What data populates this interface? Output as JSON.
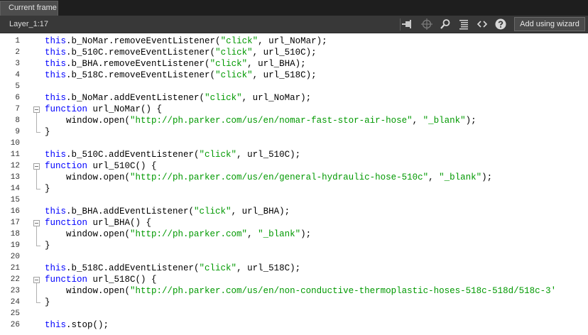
{
  "tab": {
    "label": "Current frame"
  },
  "toolbar": {
    "scope": "Layer_1:17",
    "wizard_label": "Add using wizard",
    "icons": [
      "pin-icon",
      "target-icon",
      "search-icon",
      "format-icon",
      "code-brackets-icon",
      "help-icon"
    ]
  },
  "colors": {
    "keyword": "#0000ff",
    "string": "#009900",
    "text": "#000000"
  },
  "lines": [
    {
      "num": "1",
      "tokens": [
        {
          "k": "kw",
          "t": "this"
        },
        {
          "k": "",
          "t": ".b_NoMar.removeEventListener("
        },
        {
          "k": "str",
          "t": "\"click\""
        },
        {
          "k": "",
          "t": ", url_NoMar);"
        }
      ]
    },
    {
      "num": "2",
      "tokens": [
        {
          "k": "kw",
          "t": "this"
        },
        {
          "k": "",
          "t": ".b_510C.removeEventListener("
        },
        {
          "k": "str",
          "t": "\"click\""
        },
        {
          "k": "",
          "t": ", url_510C);"
        }
      ]
    },
    {
      "num": "3",
      "tokens": [
        {
          "k": "kw",
          "t": "this"
        },
        {
          "k": "",
          "t": ".b_BHA.removeEventListener("
        },
        {
          "k": "str",
          "t": "\"click\""
        },
        {
          "k": "",
          "t": ", url_BHA);"
        }
      ]
    },
    {
      "num": "4",
      "tokens": [
        {
          "k": "kw",
          "t": "this"
        },
        {
          "k": "",
          "t": ".b_518C.removeEventListener("
        },
        {
          "k": "str",
          "t": "\"click\""
        },
        {
          "k": "",
          "t": ", url_518C);"
        }
      ]
    },
    {
      "num": "5",
      "tokens": []
    },
    {
      "num": "6",
      "tokens": [
        {
          "k": "kw",
          "t": "this"
        },
        {
          "k": "",
          "t": ".b_NoMar.addEventListener("
        },
        {
          "k": "str",
          "t": "\"click\""
        },
        {
          "k": "",
          "t": ", url_NoMar);"
        }
      ]
    },
    {
      "num": "7",
      "fold": true,
      "tokens": [
        {
          "k": "kw",
          "t": "function"
        },
        {
          "k": "",
          "t": " url_NoMar() {"
        }
      ]
    },
    {
      "num": "8",
      "tokens": [
        {
          "k": "",
          "t": "    window.open("
        },
        {
          "k": "str",
          "t": "\"http://ph.parker.com/us/en/nomar-fast-stor-air-hose\""
        },
        {
          "k": "",
          "t": ", "
        },
        {
          "k": "str",
          "t": "\"_blank\""
        },
        {
          "k": "",
          "t": ");"
        }
      ]
    },
    {
      "num": "9",
      "end": true,
      "tokens": [
        {
          "k": "",
          "t": "}"
        }
      ]
    },
    {
      "num": "10",
      "tokens": []
    },
    {
      "num": "11",
      "tokens": [
        {
          "k": "kw",
          "t": "this"
        },
        {
          "k": "",
          "t": ".b_510C.addEventListener("
        },
        {
          "k": "str",
          "t": "\"click\""
        },
        {
          "k": "",
          "t": ", url_510C);"
        }
      ]
    },
    {
      "num": "12",
      "fold": true,
      "tokens": [
        {
          "k": "kw",
          "t": "function"
        },
        {
          "k": "",
          "t": " url_510C() {"
        }
      ]
    },
    {
      "num": "13",
      "tokens": [
        {
          "k": "",
          "t": "    window.open("
        },
        {
          "k": "str",
          "t": "\"http://ph.parker.com/us/en/general-hydraulic-hose-510c\""
        },
        {
          "k": "",
          "t": ", "
        },
        {
          "k": "str",
          "t": "\"_blank\""
        },
        {
          "k": "",
          "t": ");"
        }
      ]
    },
    {
      "num": "14",
      "end": true,
      "tokens": [
        {
          "k": "",
          "t": "}"
        }
      ]
    },
    {
      "num": "15",
      "tokens": []
    },
    {
      "num": "16",
      "tokens": [
        {
          "k": "kw",
          "t": "this"
        },
        {
          "k": "",
          "t": ".b_BHA.addEventListener("
        },
        {
          "k": "str",
          "t": "\"click\""
        },
        {
          "k": "",
          "t": ", url_BHA);"
        }
      ]
    },
    {
      "num": "17",
      "fold": true,
      "tokens": [
        {
          "k": "kw",
          "t": "function"
        },
        {
          "k": "",
          "t": " url_BHA() {"
        }
      ]
    },
    {
      "num": "18",
      "tokens": [
        {
          "k": "",
          "t": "    window.open("
        },
        {
          "k": "str",
          "t": "\"http://ph.parker.com\""
        },
        {
          "k": "",
          "t": ", "
        },
        {
          "k": "str",
          "t": "\"_blank\""
        },
        {
          "k": "",
          "t": ");"
        }
      ]
    },
    {
      "num": "19",
      "end": true,
      "tokens": [
        {
          "k": "",
          "t": "}"
        }
      ]
    },
    {
      "num": "20",
      "tokens": []
    },
    {
      "num": "21",
      "tokens": [
        {
          "k": "kw",
          "t": "this"
        },
        {
          "k": "",
          "t": ".b_518C.addEventListener("
        },
        {
          "k": "str",
          "t": "\"click\""
        },
        {
          "k": "",
          "t": ", url_518C);"
        }
      ]
    },
    {
      "num": "22",
      "fold": true,
      "tokens": [
        {
          "k": "kw",
          "t": "function"
        },
        {
          "k": "",
          "t": " url_518C() {"
        }
      ]
    },
    {
      "num": "23",
      "tokens": [
        {
          "k": "",
          "t": "    window.open("
        },
        {
          "k": "str",
          "t": "\"http://ph.parker.com/us/en/non-conductive-thermoplastic-hoses-518c-518d/518c-3'"
        }
      ]
    },
    {
      "num": "24",
      "end": true,
      "tokens": [
        {
          "k": "",
          "t": "}"
        }
      ]
    },
    {
      "num": "25",
      "tokens": []
    },
    {
      "num": "26",
      "tokens": [
        {
          "k": "kw",
          "t": "this"
        },
        {
          "k": "",
          "t": ".stop();"
        }
      ]
    }
  ]
}
